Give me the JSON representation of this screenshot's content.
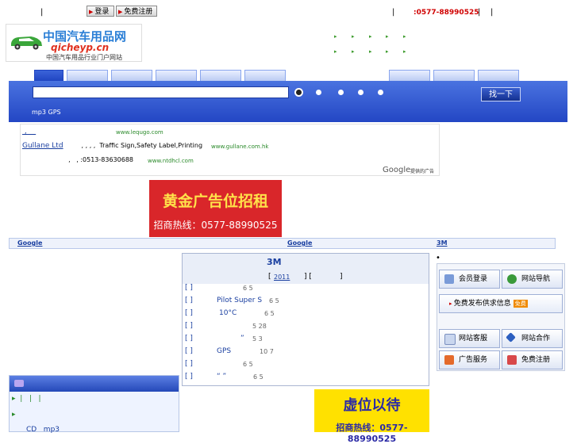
{
  "topbar": {
    "sep": "|",
    "login": "登录",
    "register": "免费注册",
    "phone": ":0577-88990525"
  },
  "logo": {
    "cn": "中国汽车用品网",
    "en": "qicheyp.cn",
    "sub": "中国汽车用品行业门户网站"
  },
  "header_arrows": "▸",
  "search": {
    "value": "",
    "button": "找一下",
    "hint": "mp3 GPS"
  },
  "ads": {
    "a1_link": " ,    ",
    "a1_url": "www.lequgo.com",
    "a2_link": "Gullane Ltd",
    "a2_text": " , , , ,  Traffic Sign,Safety Label,Printing",
    "a2_url": "www.gullane.com.hk",
    "a3_text": "  ,   , :0513-83630688",
    "a3_url": "www.ntdhcl.com",
    "google": "Google",
    "google_sub": "提供的广告"
  },
  "banner1": {
    "title": "黄金广告位招租",
    "phone": "招商热线：0577-88990525"
  },
  "linkbar": {
    "google1": "Google",
    "google2": "Google",
    "m3": "3M"
  },
  "center": {
    "title": "3M",
    "year_open": "[",
    "year": "2011",
    "year_mid": "] [",
    "year_close": "]",
    "rows": [
      {
        "l": "[ ]",
        "t": "",
        "n": "6 5"
      },
      {
        "l": "[ ]",
        "t": "Pilot Super S",
        "n": "6 5"
      },
      {
        "l": "[ ]",
        "t": "10°C",
        "n": "6 5"
      },
      {
        "l": "[ ]",
        "t": "",
        "n": "5 28"
      },
      {
        "l": "[ ]",
        "t": "”",
        "n": "5 3"
      },
      {
        "l": "[ ]",
        "t": "GPS",
        "n": "10 7"
      },
      {
        "l": "[ ]",
        "t": "",
        "n": "6 5"
      },
      {
        "l": "[ ]",
        "t": "“ ”",
        "n": "6 5"
      }
    ]
  },
  "right": {
    "bullet": "•",
    "b1": "会员登录",
    "b2": "网站导航",
    "b3": "网站客服",
    "b4": "网站合作",
    "b5": "广告服务",
    "b6": "免费注册",
    "wide": "免费发布供求信息",
    "badge": "免费"
  },
  "bottomleft": {
    "l1": "▸  |   |   |",
    "l2": "▸",
    "l3": "CD   mp3"
  },
  "banner2": {
    "title": "虚位以待",
    "phone": "招商热线：0577-88990525"
  }
}
